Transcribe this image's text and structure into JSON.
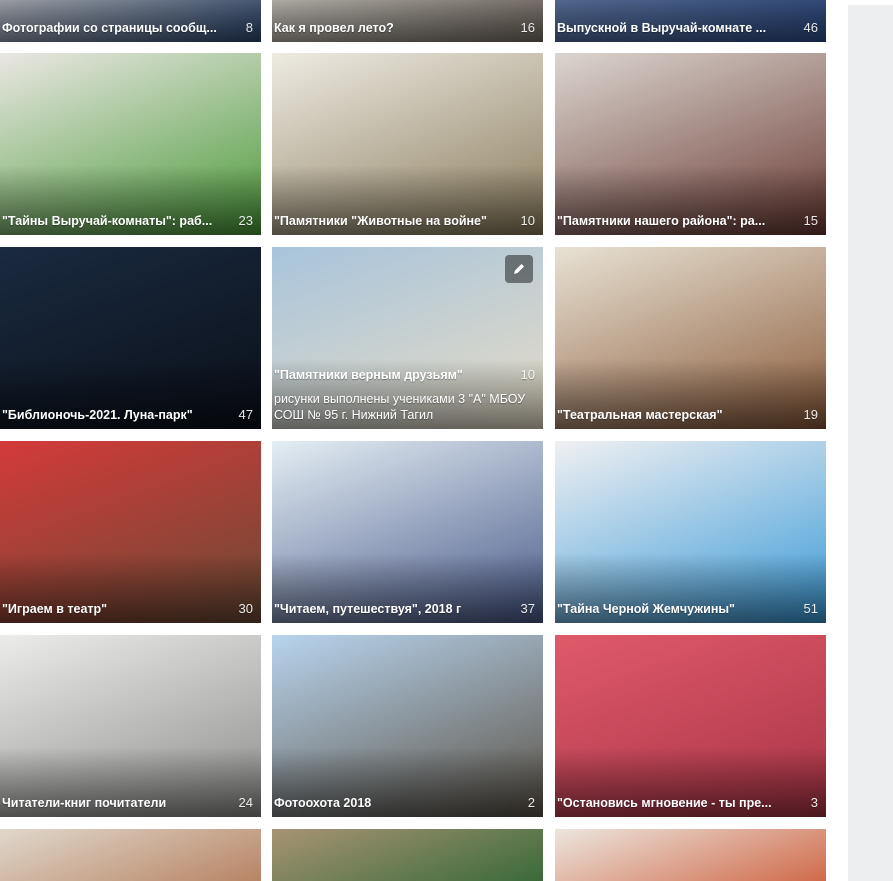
{
  "albums": [
    {
      "title": "Фотографии со страницы сообщ...",
      "count": "8",
      "colors": [
        "#d2d4d8",
        "#2d4a78"
      ]
    },
    {
      "title": "Как я провел лето?",
      "count": "16",
      "colors": [
        "#e6e2da",
        "#7a7066"
      ]
    },
    {
      "title": "Выпускной в Выручай-комнате ...",
      "count": "46",
      "colors": [
        "#6d88b8",
        "#2f4f8c"
      ]
    },
    {
      "title": "\"Тайны Выручай-комнаты\": раб...",
      "count": "23",
      "colors": [
        "#eae7e3",
        "#4a9a38"
      ]
    },
    {
      "title": "\"Памятники \"Животные на войне\"",
      "count": "10",
      "colors": [
        "#eeebe3",
        "#8a7c5c"
      ]
    },
    {
      "title": "\"Памятники нашего района\": ра...",
      "count": "15",
      "colors": [
        "#dcd6d0",
        "#6a3a34"
      ]
    },
    {
      "title": "\"Библионочь-2021. Луна-парк\"",
      "count": "47",
      "colors": [
        "#1a2a40",
        "#0a0f18"
      ]
    },
    {
      "title": "\"Памятники верным друзьям\"",
      "count": "10",
      "colors": [
        "#a8c4dc",
        "#e6dcc6"
      ],
      "description": "рисунки выполнены учениками 3 \"А\" МБОУ СОШ № 95 г. Нижний Тагил",
      "editable": true
    },
    {
      "title": "\"Театральная мастерская\"",
      "count": "19",
      "colors": [
        "#e8e2d4",
        "#8a5a3a"
      ]
    },
    {
      "title": "\"Играем в театр\"",
      "count": "30",
      "colors": [
        "#d43a3a",
        "#6a4a34"
      ]
    },
    {
      "title": "\"Читаем, путешествуя\", 2018 г",
      "count": "37",
      "colors": [
        "#e4eef4",
        "#4a5a8a"
      ]
    },
    {
      "title": "\"Тайна Черной Жемчужины\"",
      "count": "51",
      "colors": [
        "#f0f0f2",
        "#3a9ad8"
      ]
    },
    {
      "title": "Читатели-книг почитатели",
      "count": "24",
      "colors": [
        "#ececea",
        "#8c8c8a"
      ]
    },
    {
      "title": "Фотоохота 2018",
      "count": "2",
      "colors": [
        "#b8d4ee",
        "#5a5246"
      ]
    },
    {
      "title": "\"Остановись мгновение - ты пре...",
      "count": "3",
      "colors": [
        "#e05a6a",
        "#a83446"
      ]
    },
    {
      "title": "",
      "count": "",
      "colors": [
        "#e0d8cc",
        "#b88464"
      ]
    },
    {
      "title": "",
      "count": "",
      "colors": [
        "#a89474",
        "#3a6a3a"
      ]
    },
    {
      "title": "",
      "count": "",
      "colors": [
        "#ece6de",
        "#d06a4a"
      ]
    }
  ],
  "icons": {
    "edit": "pencil-icon"
  }
}
